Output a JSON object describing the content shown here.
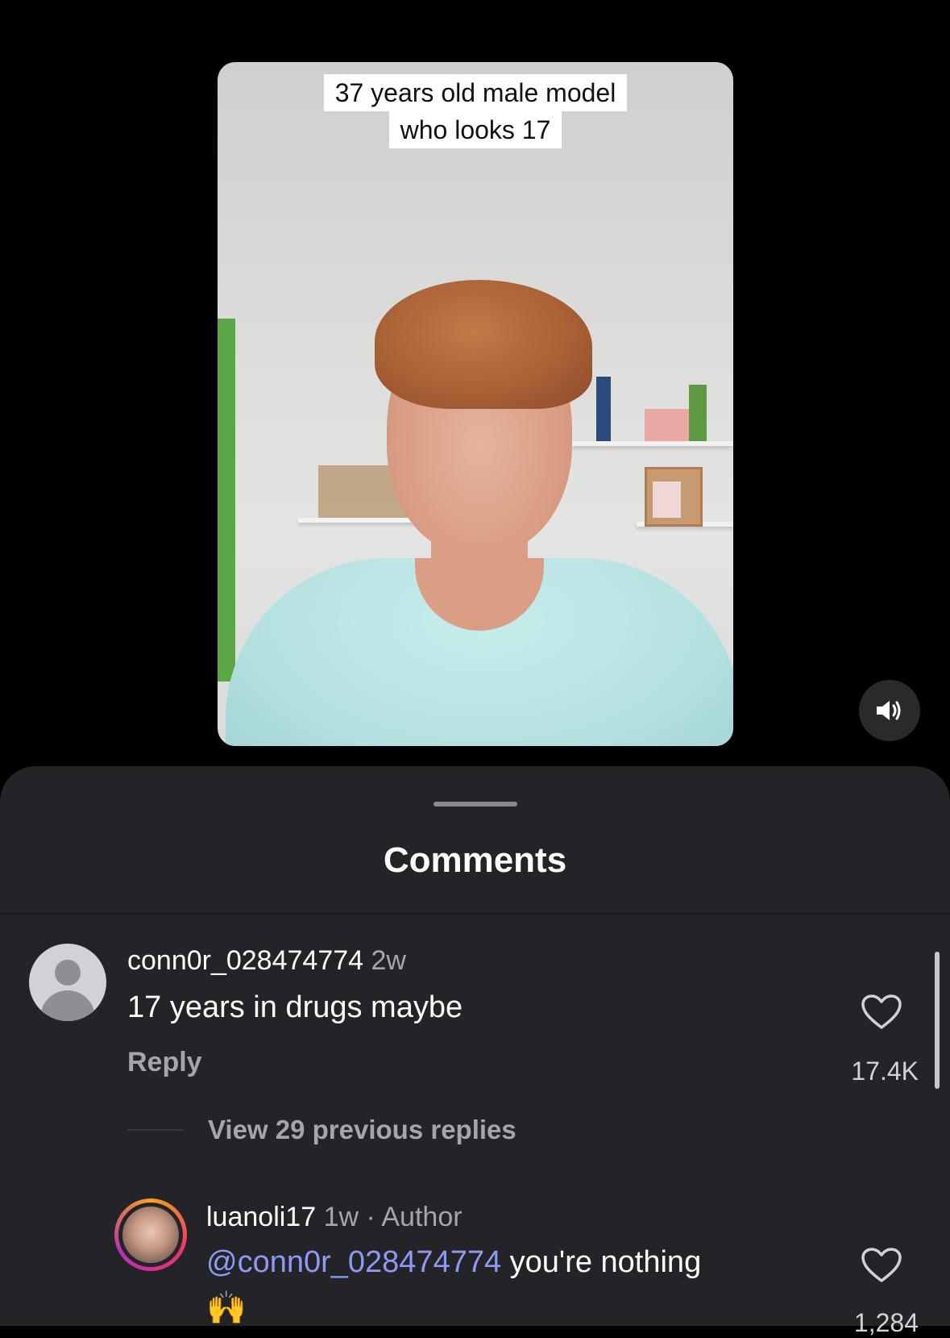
{
  "video": {
    "caption_line1": "37 years old male model",
    "caption_line2": "who looks 17",
    "mute_icon": "speaker-icon"
  },
  "sheet": {
    "title": "Comments"
  },
  "comments": [
    {
      "username": "conn0r_028474774",
      "time": "2w",
      "text": "17 years in drugs maybe",
      "reply_label": "Reply",
      "likes": "17.4K",
      "view_replies": "View 29 previous replies"
    },
    {
      "username": "luanoli17",
      "time": "1w · Author",
      "mention": "@conn0r_028474774",
      "text": " you're nothing",
      "emoji": "🙌",
      "likes": "1,284"
    }
  ],
  "colors": {
    "sheet_bg": "#232328",
    "mention": "#8c9bf2",
    "muted_text": "#a5a5aa"
  }
}
